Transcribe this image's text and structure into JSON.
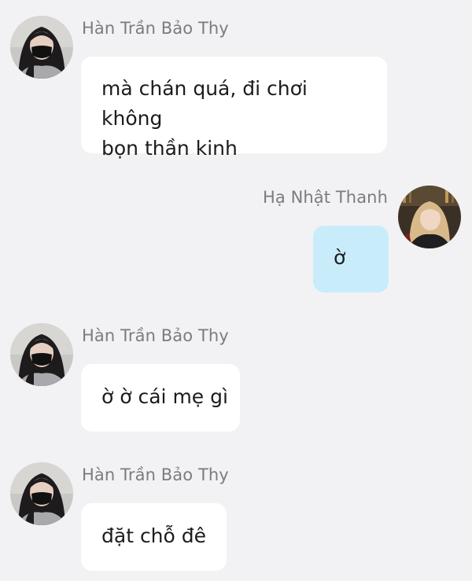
{
  "chat": {
    "messages": [
      {
        "sender": "Hàn Trần Bảo Thy",
        "avatar": "female-masked-avatar",
        "text": "mà chán quá, đi chơi không\nbọn thần kinh"
      },
      {
        "sender": "Hạ Nhật Thanh",
        "avatar": "female-avatar",
        "text": "ờ"
      },
      {
        "sender": "Hàn Trần Bảo Thy",
        "avatar": "female-masked-avatar",
        "text": "ờ ờ cái mẹ gì"
      },
      {
        "sender": "Hàn Trần Bảo Thy",
        "avatar": "female-masked-avatar",
        "text": "đặt chỗ đê"
      }
    ]
  },
  "colors": {
    "background": "#f2f2f4",
    "incoming_bubble": "#ffffff",
    "outgoing_bubble": "#c9ecfb",
    "sender_name": "#7b7b80",
    "message_text": "#1c1c1e"
  }
}
